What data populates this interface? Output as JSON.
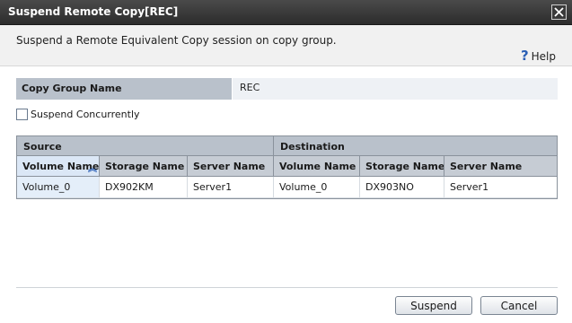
{
  "window": {
    "title": "Suspend Remote Copy[REC]",
    "close_icon": "close-icon"
  },
  "header": {
    "description": "Suspend a Remote Equivalent Copy session on copy group.",
    "help_label": "Help",
    "help_icon": "question-icon"
  },
  "copy_group": {
    "label": "Copy Group Name",
    "value": "REC"
  },
  "options": {
    "suspend_concurrently_label": "Suspend Concurrently",
    "suspend_concurrently_checked": false
  },
  "table": {
    "groups": {
      "source": "Source",
      "destination": "Destination"
    },
    "columns": [
      "Volume Name",
      "Storage Name",
      "Server Name",
      "Volume Name",
      "Storage Name",
      "Server Name"
    ],
    "sorted_column_icon": "sort-ascending-icon",
    "rows": [
      [
        "Volume_0",
        "DX902KM",
        "Server1",
        "Volume_0",
        "DX903NO",
        "Server1"
      ]
    ]
  },
  "buttons": {
    "suspend": "Suspend",
    "cancel": "Cancel"
  },
  "colors": {
    "titlebar": "#3a3a3a",
    "header_bg": "#f1f1f1",
    "label_bg": "#b9c1cb",
    "value_bg": "#eef1f5",
    "accent": "#2b5fb5"
  }
}
